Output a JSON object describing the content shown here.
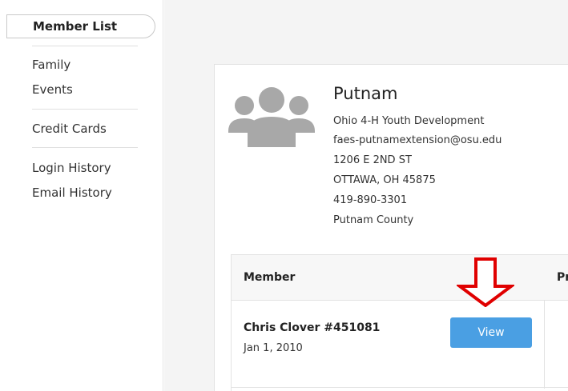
{
  "sidebar": {
    "active_item": "Member List",
    "groups": [
      [
        "Family",
        "Events"
      ],
      [
        "Credit Cards"
      ],
      [
        "Login History",
        "Email History"
      ]
    ]
  },
  "org": {
    "name": "Putnam",
    "lines": [
      "Ohio 4-H Youth Development",
      "faes-putnamextension@osu.edu",
      "1206 E 2ND ST",
      "OTTAWA, OH 45875",
      "419-890-3301",
      "Putnam County"
    ],
    "avatar_icon": "people-group-icon"
  },
  "table": {
    "columns": [
      "Member",
      "Pr"
    ],
    "rows": [
      {
        "name": "Chris Clover #451081",
        "dob": "Jan 1, 2010",
        "action_label": "View"
      }
    ]
  },
  "annotation": {
    "icon": "down-arrow-annotation-icon",
    "color": "#e00000"
  },
  "colors": {
    "button": "#4a9fe3",
    "content_bg": "#f4f4f4"
  }
}
